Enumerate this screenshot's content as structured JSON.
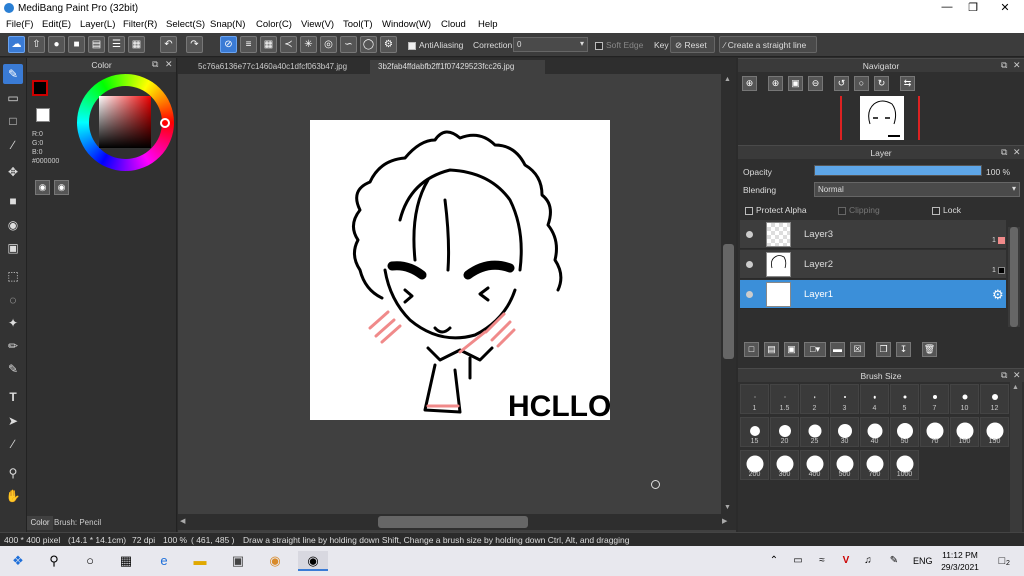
{
  "app": {
    "title": "MediBang Paint Pro (32bit)"
  },
  "menu": [
    "File(F)",
    "Edit(E)",
    "Layer(L)",
    "Filter(R)",
    "Select(S)",
    "Snap(N)",
    "Color(C)",
    "View(V)",
    "Tool(T)",
    "Window(W)",
    "Cloud",
    "Help"
  ],
  "toolbar": {
    "antialiasing_label": "AntiAliasing",
    "correction_label": "Correction",
    "correction_value": "0",
    "soft_edge_label": "Soft Edge",
    "key_label": "Key",
    "reset_label": "Reset",
    "straight_line_label": "Create a straight line"
  },
  "color_panel": {
    "title": "Color",
    "r": "R:0",
    "g": "G:0",
    "b": "B:0",
    "hex": "#000000",
    "tab_color": "Color",
    "tab_brush": "Brush: Pencil"
  },
  "tabs": [
    "5c76a6136e77c1460a40c1dfcf063b47.jpg",
    "3b2fab4ffdabfb2ff1f07429523fcc26.jpg"
  ],
  "drawing_text": "HCLLO",
  "navigator": {
    "title": "Navigator"
  },
  "layer_panel": {
    "title": "Layer",
    "opacity_label": "Opacity",
    "opacity_value": "100 %",
    "opacity_fraction": 1.0,
    "blending_label": "Blending",
    "blending_value": "Normal",
    "protect_alpha": "Protect Alpha",
    "clipping": "Clipping",
    "lock": "Lock",
    "layers": [
      {
        "name": "Layer3",
        "badge": "1"
      },
      {
        "name": "Layer2",
        "badge": "1"
      },
      {
        "name": "Layer1",
        "badge": ""
      }
    ]
  },
  "brush_panel": {
    "title": "Brush Size",
    "sizes": [
      "1",
      "1.5",
      "2",
      "3",
      "4",
      "5",
      "7",
      "10",
      "12",
      "15",
      "20",
      "25",
      "30",
      "40",
      "50",
      "70",
      "100",
      "150",
      "200",
      "300",
      "400",
      "500",
      "700",
      "1000"
    ]
  },
  "status": {
    "size": "400 * 400 pixel",
    "cm": "(14.1 * 14.1cm)",
    "dpi": "72 dpi",
    "zoom": "100 %",
    "coords": "( 461, 485 )",
    "hint": "Draw a straight line by holding down Shift, Change a brush size by holding down Ctrl, Alt, and dragging"
  },
  "taskbar": {
    "lang": "ENG",
    "time": "11:12 PM",
    "date": "29/3/2021",
    "notif": "2"
  }
}
